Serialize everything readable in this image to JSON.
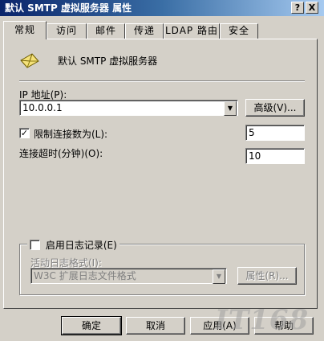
{
  "window": {
    "title": "默认 SMTP 虚拟服务器 属性",
    "help_btn": "?",
    "close_btn": "X"
  },
  "tabs": [
    {
      "label": "常规",
      "active": true
    },
    {
      "label": "访问",
      "active": false
    },
    {
      "label": "邮件",
      "active": false
    },
    {
      "label": "传递",
      "active": false
    },
    {
      "label": "LDAP 路由",
      "active": false
    },
    {
      "label": "安全",
      "active": false
    }
  ],
  "general": {
    "server_name": "默认 SMTP 虚拟服务器",
    "ip_label": "IP 地址(P):",
    "ip_value": "10.0.0.1",
    "advanced_button": "高级(V)...",
    "limit_connections_label": "限制连接数为(L):",
    "limit_connections_checked": true,
    "limit_connections_value": "5",
    "timeout_label": "连接超时(分钟)(O):",
    "timeout_value": "10"
  },
  "logging": {
    "enable_label": "启用日志记录(E)",
    "enabled": false,
    "format_label": "活动日志格式(I):",
    "format_value": "W3C 扩展日志文件格式",
    "properties_button": "属性(R)..."
  },
  "footer": {
    "ok": "确定",
    "cancel": "取消",
    "apply": "应用(A)",
    "help": "帮助"
  },
  "watermark": "IT168",
  "icons": {
    "server": "envelope-icon",
    "dropdown": "triangle-down",
    "check": "checkmark"
  }
}
